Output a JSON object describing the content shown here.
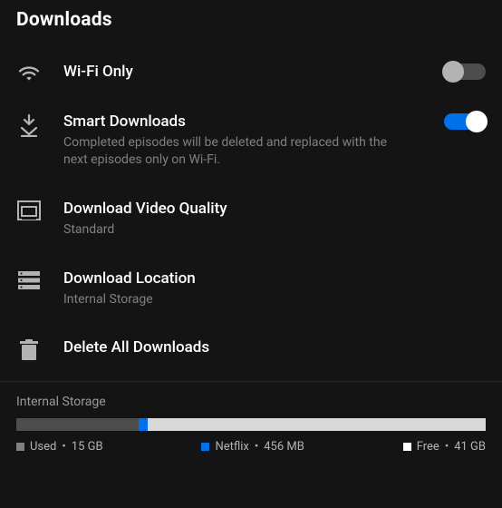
{
  "header": {
    "title": "Downloads"
  },
  "rows": {
    "wifi": {
      "title": "Wi-Fi Only",
      "enabled": false
    },
    "smart": {
      "title": "Smart Downloads",
      "subtitle": "Completed episodes will be deleted and replaced with the next episodes only on Wi-Fi.",
      "enabled": true
    },
    "quality": {
      "title": "Download Video Quality",
      "value": "Standard"
    },
    "location": {
      "title": "Download Location",
      "value": "Internal Storage"
    },
    "delete": {
      "title": "Delete All Downloads"
    }
  },
  "storage": {
    "label": "Internal Storage",
    "segments": {
      "used": {
        "label": "Used",
        "value": "15 GB",
        "pct": 26
      },
      "netflix": {
        "label": "Netflix",
        "value": "456 MB",
        "pct": 2
      },
      "free": {
        "label": "Free",
        "value": "41 GB",
        "pct": 72
      }
    }
  }
}
